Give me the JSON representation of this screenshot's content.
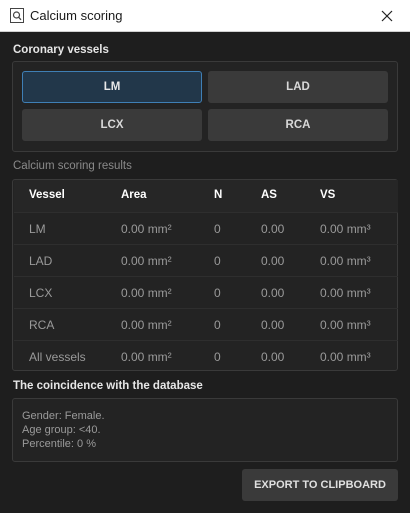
{
  "window": {
    "title": "Calcium scoring"
  },
  "vessels": {
    "heading": "Coronary vessels",
    "buttons": [
      {
        "label": "LM",
        "selected": true
      },
      {
        "label": "LAD",
        "selected": false
      },
      {
        "label": "LCX",
        "selected": false
      },
      {
        "label": "RCA",
        "selected": false
      }
    ]
  },
  "results": {
    "heading": "Calcium scoring results",
    "columns": [
      "Vessel",
      "Area",
      "N",
      "AS",
      "VS"
    ],
    "rows": [
      [
        "LM",
        "0.00 mm²",
        "0",
        "0.00",
        "0.00 mm³"
      ],
      [
        "LAD",
        "0.00 mm²",
        "0",
        "0.00",
        "0.00 mm³"
      ],
      [
        "LCX",
        "0.00 mm²",
        "0",
        "0.00",
        "0.00 mm³"
      ],
      [
        "RCA",
        "0.00 mm²",
        "0",
        "0.00",
        "0.00 mm³"
      ],
      [
        "All vessels",
        "0.00 mm²",
        "0",
        "0.00",
        "0.00 mm³"
      ]
    ]
  },
  "database": {
    "heading": "The coincidence with the database",
    "lines": [
      "Gender: Female.",
      "Age group: <40.",
      "Percentile: 0 %"
    ]
  },
  "actions": {
    "export_label": "EXPORT TO CLIPBOARD"
  },
  "colors": {
    "accent": "#3f7fb5",
    "selected_bg": "#22374a",
    "background": "#1e1e1e",
    "button": "#3a3a3a"
  },
  "icons": {
    "app": "document-search-icon",
    "close": "close-icon"
  }
}
